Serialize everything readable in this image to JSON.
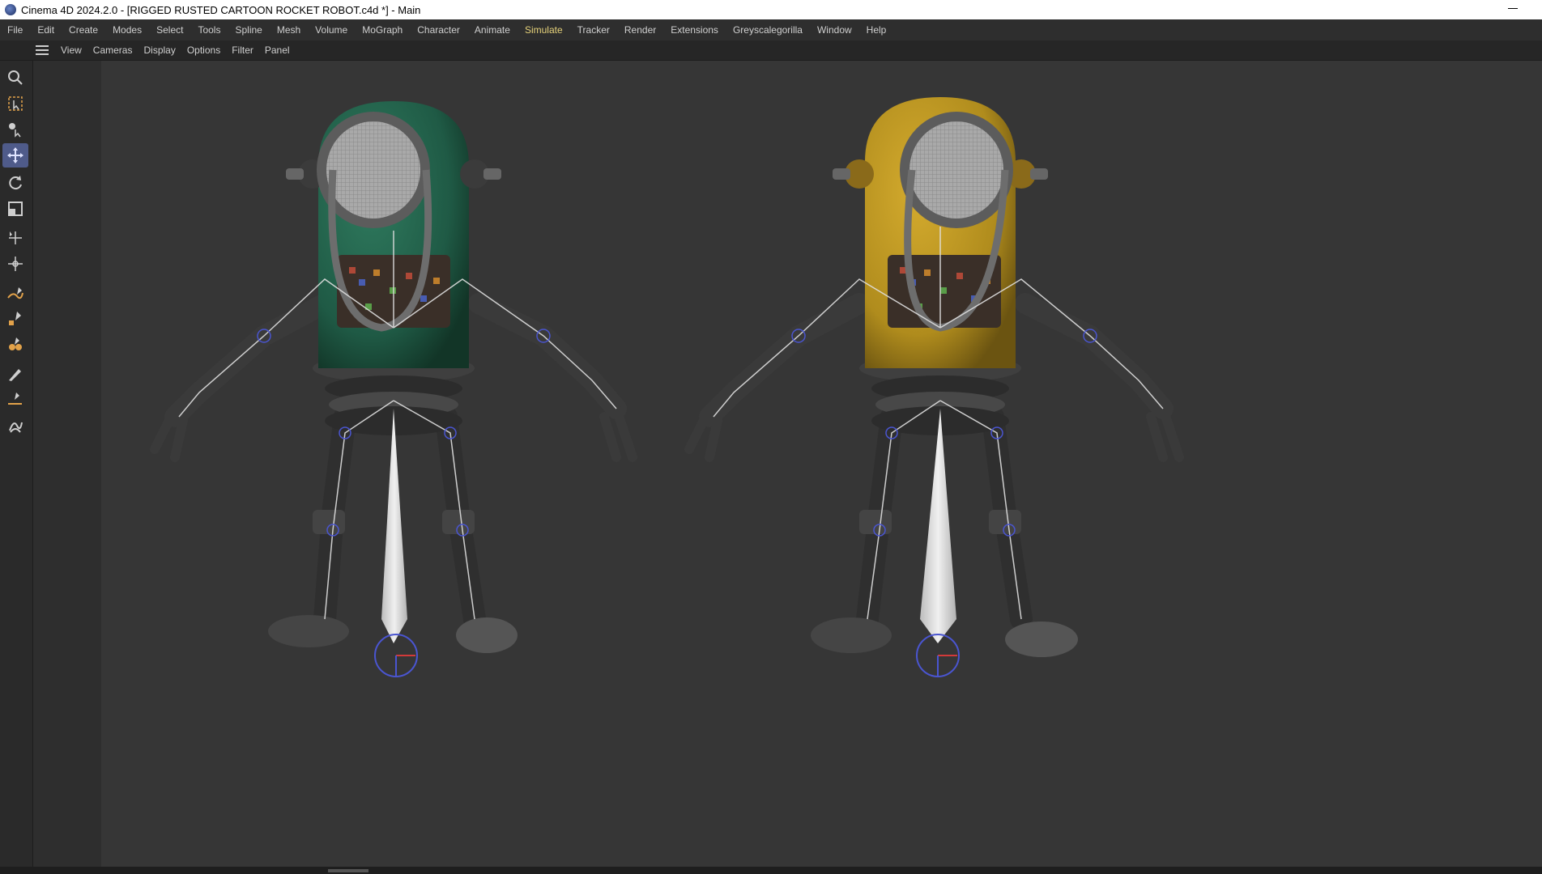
{
  "window": {
    "title": "Cinema 4D 2024.2.0 - [RIGGED RUSTED CARTOON ROCKET ROBOT.c4d *] - Main"
  },
  "menu": [
    "File",
    "Edit",
    "Create",
    "Modes",
    "Select",
    "Tools",
    "Spline",
    "Mesh",
    "Volume",
    "MoGraph",
    "Character",
    "Animate",
    "Simulate",
    "Tracker",
    "Render",
    "Extensions",
    "Greyscalegorilla",
    "Window",
    "Help"
  ],
  "menu_active": "Simulate",
  "viewport_menu": [
    "View",
    "Cameras",
    "Display",
    "Options",
    "Filter",
    "Panel"
  ],
  "tools": [
    {
      "icon": "search-icon",
      "active": false
    },
    {
      "icon": "live-selection-icon",
      "active": false
    },
    {
      "icon": "tweak-tool-icon",
      "active": false
    },
    {
      "icon": "move-icon",
      "active": true
    },
    {
      "icon": "rotate-icon",
      "active": false
    },
    {
      "icon": "scale-icon",
      "active": false
    },
    {
      "icon": "placement-tool-icon",
      "active": false
    },
    {
      "icon": "transfer-tool-icon",
      "active": false
    },
    {
      "icon": "spline-pen-icon",
      "active": false
    },
    {
      "icon": "spline-sketch-icon",
      "active": false
    },
    {
      "icon": "spline-smooth-icon",
      "active": false
    },
    {
      "icon": "paint-brush-icon",
      "active": false
    },
    {
      "icon": "spline-arc-icon",
      "active": false
    },
    {
      "icon": "spline-helix-icon",
      "active": false
    }
  ],
  "colors": {
    "active_tool": "#4f5b8a",
    "active_menu": "#e6d27a",
    "robot_green": "#1f5a45",
    "robot_yellow": "#b08c1d",
    "bone": "#d8d8d8",
    "joint": "#4a55d0"
  },
  "scene": {
    "robots": [
      {
        "name": "green-robot",
        "color": "#1f5a45"
      },
      {
        "name": "yellow-robot",
        "color": "#b08c1d"
      }
    ]
  }
}
